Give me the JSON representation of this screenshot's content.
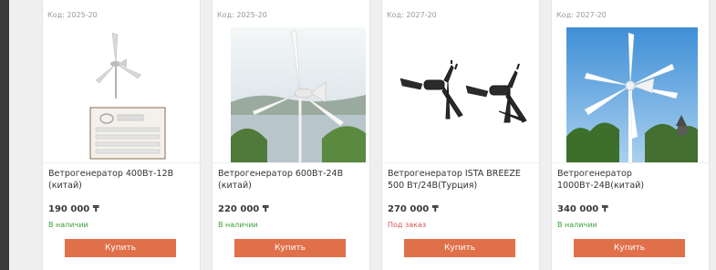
{
  "products": [
    {
      "code": "Код: 2025-20",
      "title": "Ветрогенератор 400Вт-12В (китай)",
      "price": "190 000 ₸",
      "stock": "В наличии",
      "stock_color": "#3aa03a",
      "buy": "Купить",
      "image": "turbine-with-parts"
    },
    {
      "code": "Код: 2025-20",
      "title": "Ветрогенератор 600Вт-24В (китай)",
      "price": "220 000 ₸",
      "stock": "В наличии",
      "stock_color": "#3aa03a",
      "buy": "Купить",
      "image": "turbine-by-lake"
    },
    {
      "code": "Код: 2027-20",
      "title": "Ветрогенератор ISTA BREEZE 500 Вт/24В(Турция)",
      "price": "270 000 ₸",
      "stock": "Под заказ",
      "stock_color": "#d9534f",
      "buy": "Купить",
      "image": "two-black-turbines"
    },
    {
      "code": "Код: 2027-20",
      "title": "Ветрогенератор 1000Вт-24В(китай)",
      "price": "340 000 ₸",
      "stock": "В наличии",
      "stock_color": "#3aa03a",
      "buy": "Купить",
      "image": "six-blade-turbine"
    }
  ]
}
